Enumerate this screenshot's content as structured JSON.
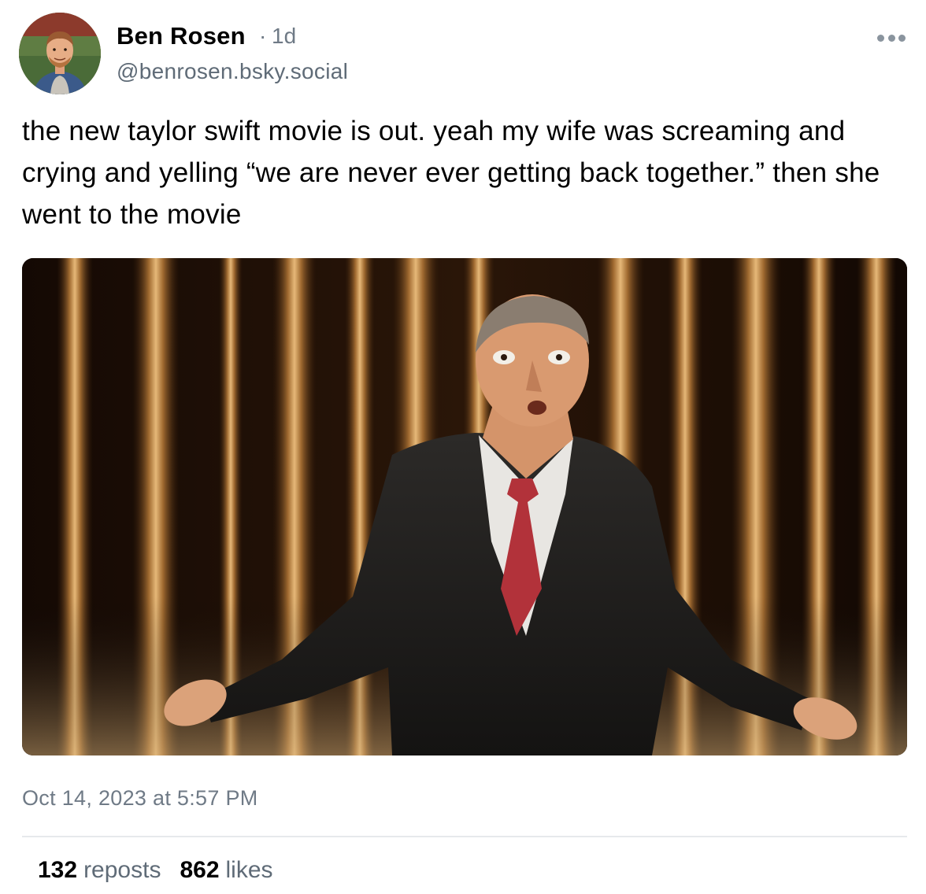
{
  "author": {
    "display_name": "Ben Rosen",
    "separator": "·",
    "time_ago": "1d",
    "handle": "@benrosen.bsky.social",
    "avatar_icon": "user-avatar-photo"
  },
  "menu": {
    "icon": "more-options-icon"
  },
  "post": {
    "text": "the new taylor swift movie is out. yeah my wife was screaming and crying and yelling “we are never ever getting back together.” then she went to the movie",
    "image_description_icon": "embedded-photo",
    "timestamp": "Oct 14, 2023 at 5:57 PM"
  },
  "stats": {
    "reposts_count": "132",
    "reposts_label": "reposts",
    "likes_count": "862",
    "likes_label": "likes"
  },
  "colors": {
    "text_primary": "#000000",
    "text_secondary": "#6f7a86",
    "divider": "#e6e9ec"
  }
}
